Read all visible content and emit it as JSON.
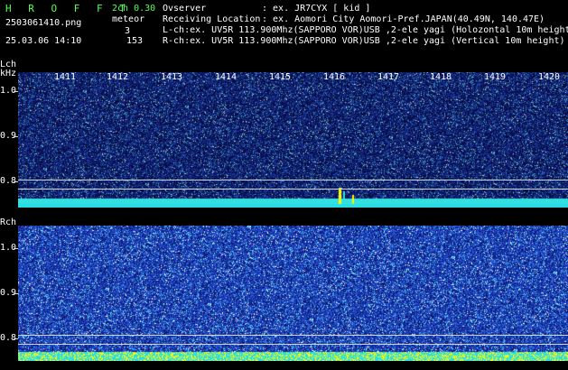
{
  "header": {
    "brand": "H R O F F T",
    "filename": "2503061410.png",
    "datetime": "25.03.06 14:10",
    "mode": "2ch 0.30",
    "event_label": "meteor",
    "lch_count": "3",
    "rch_count": "153",
    "observer_label": "Ovserver",
    "observer_value": ": ex. JR7CYX [ kid ]",
    "location_label": "Receiving Location",
    "location_value": ": ex. Aomori City Aomori-Pref.JAPAN(40.49N, 140.47E)",
    "lch_info": "L-ch:ex. UV5R 113.900Mhz(SAPPORO VOR)USB ,2-ele yagi (Holozontal 10m height)",
    "rch_info": "R-ch:ex. UV5R 113.900Mhz(SAPPORO VOR)USB ,2-ele yagi (Vertical 10m height)"
  },
  "lch_panel": {
    "channel_label": "Lch",
    "unit_label": "kHz",
    "time_ticks": [
      "1411",
      "1412",
      "1413",
      "1414",
      "1415",
      "1416",
      "1417",
      "1418",
      "1419",
      "1420"
    ],
    "freq_ticks": [
      "1.0",
      "0.9",
      "0.8"
    ]
  },
  "rch_panel": {
    "channel_label": "Rch",
    "freq_ticks": [
      "1.0",
      "0.9",
      "0.8"
    ]
  },
  "colors": {
    "background": "#000000",
    "text_green": "#55ff55",
    "text_white": "#ffffff",
    "noise_blue": "#1a2a9e",
    "baseline_cyan": "#33e0e0",
    "echo_yellow": "#ffff00"
  }
}
